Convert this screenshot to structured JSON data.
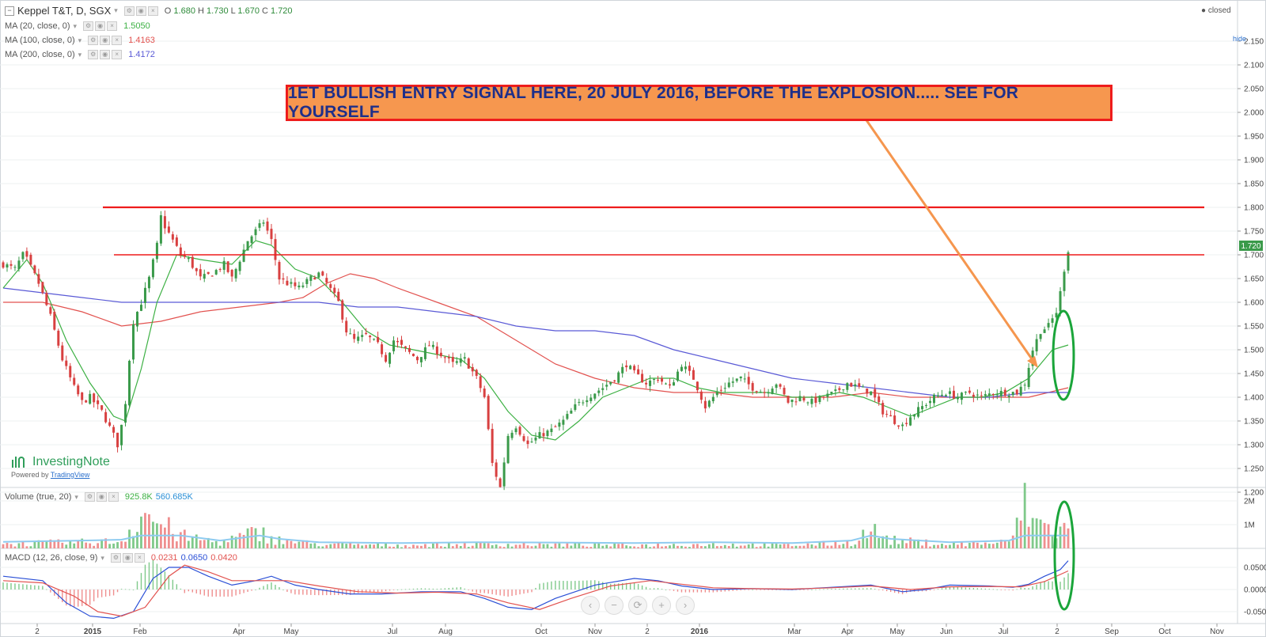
{
  "header": {
    "symbol": "Keppel T&T, D, SGX",
    "ohlc": [
      {
        "k": "O",
        "v": "1.680"
      },
      {
        "k": "H",
        "v": "1.730"
      },
      {
        "k": "L",
        "v": "1.670"
      },
      {
        "k": "C",
        "v": "1.720"
      }
    ],
    "status": "● closed",
    "hide_label": "hide"
  },
  "indicators": [
    {
      "label": "MA (20, close, 0)",
      "value": "1.5050",
      "color": "#3cb043"
    },
    {
      "label": "MA (100, close, 0)",
      "value": "1.4163",
      "color": "#e2524f"
    },
    {
      "label": "MA (200, close, 0)",
      "value": "1.4172",
      "color": "#5a5ad6"
    }
  ],
  "volume_legend": {
    "label": "Volume (true, 20)",
    "v1": "925.8K",
    "v1_color": "#3cb043",
    "v2": "560.685K",
    "v2_color": "#2a8fd6"
  },
  "macd_legend": {
    "label": "MACD (12, 26, close, 9)",
    "v1": "0.0231",
    "v1_color": "#e2524f",
    "v2": "0.0650",
    "v2_color": "#2a4fd6",
    "v3": "0.0420",
    "v3_color": "#e2524f"
  },
  "annotation": {
    "text": "1ET BULLISH ENTRY SIGNAL HERE, 20 JULY 2016, BEFORE THE EXPLOSION..... SEE FOR YOURSELF"
  },
  "watermark": {
    "name": "InvestingNote",
    "powered_prefix": "Powered by ",
    "powered_link": "TradingView"
  },
  "navbar": [
    "‹",
    "−",
    "⟳",
    "+",
    "›"
  ],
  "colors": {
    "up": "#3a9a4a",
    "down": "#d84040",
    "resistance": "#ee1c1c",
    "arrow": "#f5964e",
    "highlight": "#1aa53a",
    "ma20": "#3cb043",
    "ma100": "#e2524f",
    "ma200": "#5a5ad6",
    "vol_ma": "#8ecbf0",
    "macd": "#2a4fd6",
    "signal": "#e2524f"
  },
  "chart_data": {
    "type": "candlestick",
    "symbol": "Keppel T&T",
    "interval": "D",
    "exchange": "SGX",
    "price_axis": {
      "ticks": [
        "2.150",
        "2.100",
        "2.050",
        "2.000",
        "1.950",
        "1.900",
        "1.850",
        "1.800",
        "1.750",
        "1.700",
        "1.650",
        "1.600",
        "1.550",
        "1.500",
        "1.450",
        "1.400",
        "1.350",
        "1.300",
        "1.250",
        "1.200"
      ],
      "last_price": "1.720"
    },
    "volume_axis": {
      "ticks": [
        "2M",
        "1M"
      ]
    },
    "macd_axis": {
      "ticks": [
        "0.0500",
        "0.0000",
        "-0.0500"
      ]
    },
    "x_axis": {
      "labels": [
        "2",
        "2015",
        "Feb",
        "Apr",
        "May",
        "Jul",
        "Aug",
        "Oct",
        "Nov",
        "2",
        "2016",
        "Mar",
        "Apr",
        "May",
        "Jun",
        "Jul",
        "2",
        "Sep",
        "Oct",
        "Nov"
      ],
      "bold": [
        "2015",
        "2016"
      ]
    },
    "price_path": [
      [
        0,
        1.68
      ],
      [
        3,
        1.67
      ],
      [
        5,
        1.7
      ],
      [
        6,
        1.69
      ],
      [
        9,
        1.64
      ],
      [
        12,
        1.57
      ],
      [
        15,
        1.48
      ],
      [
        18,
        1.42
      ],
      [
        20,
        1.39
      ],
      [
        22,
        1.4
      ],
      [
        25,
        1.37
      ],
      [
        28,
        1.32
      ],
      [
        29,
        1.3
      ],
      [
        30,
        1.34
      ],
      [
        31,
        1.39
      ],
      [
        32,
        1.48
      ],
      [
        33,
        1.56
      ],
      [
        35,
        1.6
      ],
      [
        37,
        1.65
      ],
      [
        39,
        1.72
      ],
      [
        40,
        1.78
      ],
      [
        41,
        1.76
      ],
      [
        43,
        1.73
      ],
      [
        45,
        1.7
      ],
      [
        47,
        1.69
      ],
      [
        50,
        1.65
      ],
      [
        53,
        1.66
      ],
      [
        56,
        1.68
      ],
      [
        58,
        1.65
      ],
      [
        60,
        1.69
      ],
      [
        62,
        1.73
      ],
      [
        64,
        1.75
      ],
      [
        66,
        1.77
      ],
      [
        68,
        1.73
      ],
      [
        70,
        1.65
      ],
      [
        72,
        1.64
      ],
      [
        75,
        1.63
      ],
      [
        78,
        1.65
      ],
      [
        80,
        1.66
      ],
      [
        82,
        1.64
      ],
      [
        85,
        1.6
      ],
      [
        87,
        1.54
      ],
      [
        89,
        1.52
      ],
      [
        92,
        1.53
      ],
      [
        95,
        1.51
      ],
      [
        97,
        1.48
      ],
      [
        99,
        1.52
      ],
      [
        102,
        1.5
      ],
      [
        105,
        1.48
      ],
      [
        108,
        1.51
      ],
      [
        111,
        1.49
      ],
      [
        114,
        1.47
      ],
      [
        117,
        1.48
      ],
      [
        120,
        1.44
      ],
      [
        122,
        1.4
      ],
      [
        124,
        1.26
      ],
      [
        126,
        1.21
      ],
      [
        128,
        1.32
      ],
      [
        130,
        1.34
      ],
      [
        133,
        1.3
      ],
      [
        136,
        1.32
      ],
      [
        139,
        1.33
      ],
      [
        142,
        1.35
      ],
      [
        145,
        1.38
      ],
      [
        148,
        1.4
      ],
      [
        152,
        1.42
      ],
      [
        155,
        1.44
      ],
      [
        158,
        1.47
      ],
      [
        160,
        1.45
      ],
      [
        163,
        1.43
      ],
      [
        166,
        1.44
      ],
      [
        169,
        1.42
      ],
      [
        172,
        1.47
      ],
      [
        175,
        1.44
      ],
      [
        178,
        1.38
      ],
      [
        181,
        1.41
      ],
      [
        184,
        1.43
      ],
      [
        187,
        1.44
      ],
      [
        190,
        1.42
      ],
      [
        193,
        1.41
      ],
      [
        196,
        1.43
      ],
      [
        199,
        1.39
      ],
      [
        202,
        1.4
      ],
      [
        205,
        1.39
      ],
      [
        208,
        1.4
      ],
      [
        211,
        1.41
      ],
      [
        214,
        1.43
      ],
      [
        217,
        1.42
      ],
      [
        220,
        1.41
      ],
      [
        223,
        1.37
      ],
      [
        226,
        1.35
      ],
      [
        228,
        1.34
      ],
      [
        230,
        1.36
      ],
      [
        233,
        1.38
      ],
      [
        236,
        1.4
      ],
      [
        239,
        1.41
      ],
      [
        242,
        1.4
      ],
      [
        245,
        1.41
      ],
      [
        248,
        1.4
      ],
      [
        251,
        1.41
      ],
      [
        254,
        1.41
      ],
      [
        257,
        1.41
      ],
      [
        259,
        1.43
      ],
      [
        261,
        1.5
      ],
      [
        263,
        1.54
      ],
      [
        265,
        1.55
      ],
      [
        267,
        1.58
      ],
      [
        268,
        1.62
      ],
      [
        269,
        1.67
      ],
      [
        270,
        1.71
      ]
    ],
    "ma20_path": [
      [
        0,
        1.63
      ],
      [
        6,
        1.69
      ],
      [
        10,
        1.64
      ],
      [
        16,
        1.52
      ],
      [
        22,
        1.43
      ],
      [
        28,
        1.36
      ],
      [
        31,
        1.35
      ],
      [
        35,
        1.46
      ],
      [
        39,
        1.6
      ],
      [
        44,
        1.7
      ],
      [
        50,
        1.69
      ],
      [
        58,
        1.68
      ],
      [
        64,
        1.73
      ],
      [
        68,
        1.72
      ],
      [
        74,
        1.67
      ],
      [
        80,
        1.65
      ],
      [
        86,
        1.6
      ],
      [
        92,
        1.54
      ],
      [
        98,
        1.51
      ],
      [
        104,
        1.5
      ],
      [
        110,
        1.49
      ],
      [
        116,
        1.48
      ],
      [
        122,
        1.44
      ],
      [
        128,
        1.37
      ],
      [
        134,
        1.32
      ],
      [
        140,
        1.31
      ],
      [
        146,
        1.35
      ],
      [
        152,
        1.4
      ],
      [
        158,
        1.42
      ],
      [
        164,
        1.44
      ],
      [
        170,
        1.44
      ],
      [
        176,
        1.42
      ],
      [
        182,
        1.41
      ],
      [
        188,
        1.41
      ],
      [
        194,
        1.41
      ],
      [
        200,
        1.4
      ],
      [
        206,
        1.4
      ],
      [
        212,
        1.41
      ],
      [
        218,
        1.4
      ],
      [
        224,
        1.38
      ],
      [
        230,
        1.36
      ],
      [
        236,
        1.38
      ],
      [
        242,
        1.4
      ],
      [
        248,
        1.4
      ],
      [
        254,
        1.41
      ],
      [
        260,
        1.44
      ],
      [
        266,
        1.5
      ],
      [
        270,
        1.51
      ]
    ],
    "ma100_path": [
      [
        0,
        1.6
      ],
      [
        10,
        1.6
      ],
      [
        20,
        1.58
      ],
      [
        30,
        1.55
      ],
      [
        40,
        1.56
      ],
      [
        50,
        1.58
      ],
      [
        60,
        1.59
      ],
      [
        70,
        1.6
      ],
      [
        76,
        1.61
      ],
      [
        82,
        1.64
      ],
      [
        88,
        1.66
      ],
      [
        94,
        1.65
      ],
      [
        100,
        1.63
      ],
      [
        110,
        1.6
      ],
      [
        120,
        1.57
      ],
      [
        130,
        1.52
      ],
      [
        140,
        1.47
      ],
      [
        150,
        1.44
      ],
      [
        160,
        1.42
      ],
      [
        170,
        1.41
      ],
      [
        180,
        1.41
      ],
      [
        190,
        1.4
      ],
      [
        200,
        1.4
      ],
      [
        210,
        1.4
      ],
      [
        220,
        1.41
      ],
      [
        230,
        1.4
      ],
      [
        240,
        1.4
      ],
      [
        250,
        1.4
      ],
      [
        260,
        1.4
      ],
      [
        270,
        1.42
      ]
    ],
    "ma200_path": [
      [
        0,
        1.63
      ],
      [
        10,
        1.62
      ],
      [
        20,
        1.61
      ],
      [
        30,
        1.6
      ],
      [
        40,
        1.6
      ],
      [
        50,
        1.6
      ],
      [
        60,
        1.6
      ],
      [
        70,
        1.6
      ],
      [
        80,
        1.6
      ],
      [
        90,
        1.59
      ],
      [
        100,
        1.59
      ],
      [
        110,
        1.58
      ],
      [
        120,
        1.57
      ],
      [
        130,
        1.55
      ],
      [
        140,
        1.54
      ],
      [
        150,
        1.54
      ],
      [
        160,
        1.53
      ],
      [
        170,
        1.5
      ],
      [
        180,
        1.48
      ],
      [
        190,
        1.46
      ],
      [
        200,
        1.44
      ],
      [
        210,
        1.43
      ],
      [
        220,
        1.42
      ],
      [
        230,
        1.41
      ],
      [
        240,
        1.4
      ],
      [
        250,
        1.4
      ],
      [
        260,
        1.41
      ],
      [
        270,
        1.41
      ]
    ],
    "resistance_levels": [
      1.8,
      1.7
    ],
    "volume_path": [
      [
        0,
        0.22
      ],
      [
        20,
        0.3
      ],
      [
        30,
        0.35
      ],
      [
        35,
        1.8
      ],
      [
        40,
        1.2
      ],
      [
        45,
        0.6
      ],
      [
        55,
        0.3
      ],
      [
        65,
        0.8
      ],
      [
        70,
        0.4
      ],
      [
        80,
        0.2
      ],
      [
        100,
        0.15
      ],
      [
        120,
        0.2
      ],
      [
        140,
        0.18
      ],
      [
        160,
        0.15
      ],
      [
        180,
        0.2
      ],
      [
        200,
        0.15
      ],
      [
        215,
        0.3
      ],
      [
        220,
        0.9
      ],
      [
        225,
        0.4
      ],
      [
        240,
        0.2
      ],
      [
        255,
        0.3
      ],
      [
        259,
        2.1
      ],
      [
        262,
        1.3
      ],
      [
        266,
        0.9
      ],
      [
        270,
        0.926
      ]
    ],
    "macd_path": [
      [
        0,
        0.03
      ],
      [
        10,
        0.02
      ],
      [
        16,
        -0.03
      ],
      [
        22,
        -0.06
      ],
      [
        28,
        -0.065
      ],
      [
        33,
        -0.05
      ],
      [
        38,
        0.025
      ],
      [
        42,
        0.05
      ],
      [
        47,
        0.05
      ],
      [
        52,
        0.03
      ],
      [
        58,
        0.01
      ],
      [
        64,
        0.02
      ],
      [
        68,
        0.03
      ],
      [
        74,
        0.01
      ],
      [
        80,
        0.0
      ],
      [
        88,
        -0.01
      ],
      [
        96,
        -0.01
      ],
      [
        106,
        -0.005
      ],
      [
        116,
        -0.005
      ],
      [
        122,
        -0.02
      ],
      [
        128,
        -0.04
      ],
      [
        134,
        -0.045
      ],
      [
        140,
        -0.02
      ],
      [
        150,
        0.01
      ],
      [
        160,
        0.025
      ],
      [
        166,
        0.02
      ],
      [
        172,
        0.008
      ],
      [
        180,
        0.0
      ],
      [
        190,
        0.002
      ],
      [
        200,
        0.0
      ],
      [
        210,
        0.005
      ],
      [
        220,
        0.01
      ],
      [
        228,
        -0.005
      ],
      [
        234,
        0.0
      ],
      [
        240,
        0.01
      ],
      [
        250,
        0.008
      ],
      [
        256,
        0.005
      ],
      [
        260,
        0.012
      ],
      [
        264,
        0.03
      ],
      [
        268,
        0.045
      ],
      [
        270,
        0.065
      ]
    ],
    "signal_path": [
      [
        0,
        0.02
      ],
      [
        10,
        0.015
      ],
      [
        18,
        -0.015
      ],
      [
        24,
        -0.05
      ],
      [
        30,
        -0.06
      ],
      [
        36,
        -0.04
      ],
      [
        42,
        0.03
      ],
      [
        46,
        0.055
      ],
      [
        52,
        0.04
      ],
      [
        58,
        0.02
      ],
      [
        66,
        0.02
      ],
      [
        72,
        0.02
      ],
      [
        80,
        0.008
      ],
      [
        90,
        -0.005
      ],
      [
        100,
        -0.008
      ],
      [
        110,
        -0.006
      ],
      [
        120,
        -0.01
      ],
      [
        128,
        -0.03
      ],
      [
        136,
        -0.045
      ],
      [
        144,
        -0.02
      ],
      [
        154,
        0.008
      ],
      [
        164,
        0.02
      ],
      [
        172,
        0.012
      ],
      [
        180,
        0.004
      ],
      [
        190,
        0.002
      ],
      [
        200,
        0.001
      ],
      [
        210,
        0.004
      ],
      [
        220,
        0.008
      ],
      [
        230,
        0.0
      ],
      [
        240,
        0.006
      ],
      [
        250,
        0.007
      ],
      [
        258,
        0.006
      ],
      [
        264,
        0.018
      ],
      [
        270,
        0.042
      ]
    ],
    "signal_date": "20 JULY 2016"
  }
}
